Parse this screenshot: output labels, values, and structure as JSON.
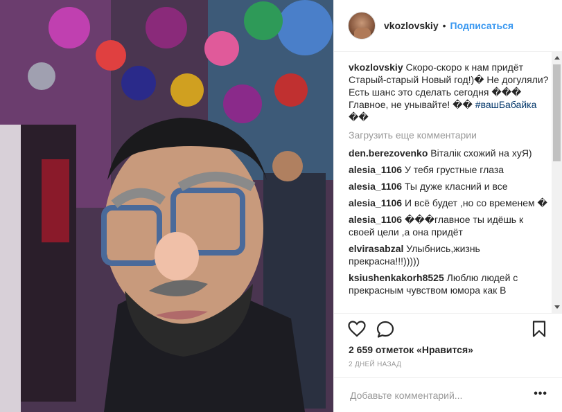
{
  "post": {
    "username": "vkozlovskiy",
    "separator": "•",
    "follow_label": "Подписаться"
  },
  "caption": {
    "author": "vkozlovskiy",
    "text": "Скоро-скоро к нам придёт Старый-старый Новый год!)� Не догуляли? Есть шанс это сделать сегодня ��� Главное, не унывайте! �� ",
    "hashtag": "#вашБабайка",
    "trailing": " ��"
  },
  "load_more_label": "Загрузить еще комментарии",
  "comments": [
    {
      "author": "den.berezovenko",
      "text": "Віталік схожий на хуЯ)"
    },
    {
      "author": "alesia_1106",
      "text": "У тебя грустные глаза"
    },
    {
      "author": "alesia_1106",
      "text": "Ты дуже класний и все"
    },
    {
      "author": "alesia_1106",
      "text": "И всё будет ,но со временем �"
    },
    {
      "author": "alesia_1106",
      "text": "���главное ты идёшь к своей цели ,а она придёт"
    },
    {
      "author": "elvirasabzal",
      "text": "Улыбнись,жизнь прекрасна!!!)))))"
    },
    {
      "author": "ksiushenkakorh8525",
      "text": "Люблю людей с прекрасным чувством юмора как В"
    }
  ],
  "likes_text": "2 659 отметок «Нравится»",
  "time_text": "2 ДНЕЙ НАЗАД",
  "add_comment_placeholder": "Добавьте комментарий...",
  "more_label": "•••",
  "icons": [
    "heart-icon",
    "comment-icon",
    "bookmark-icon"
  ]
}
